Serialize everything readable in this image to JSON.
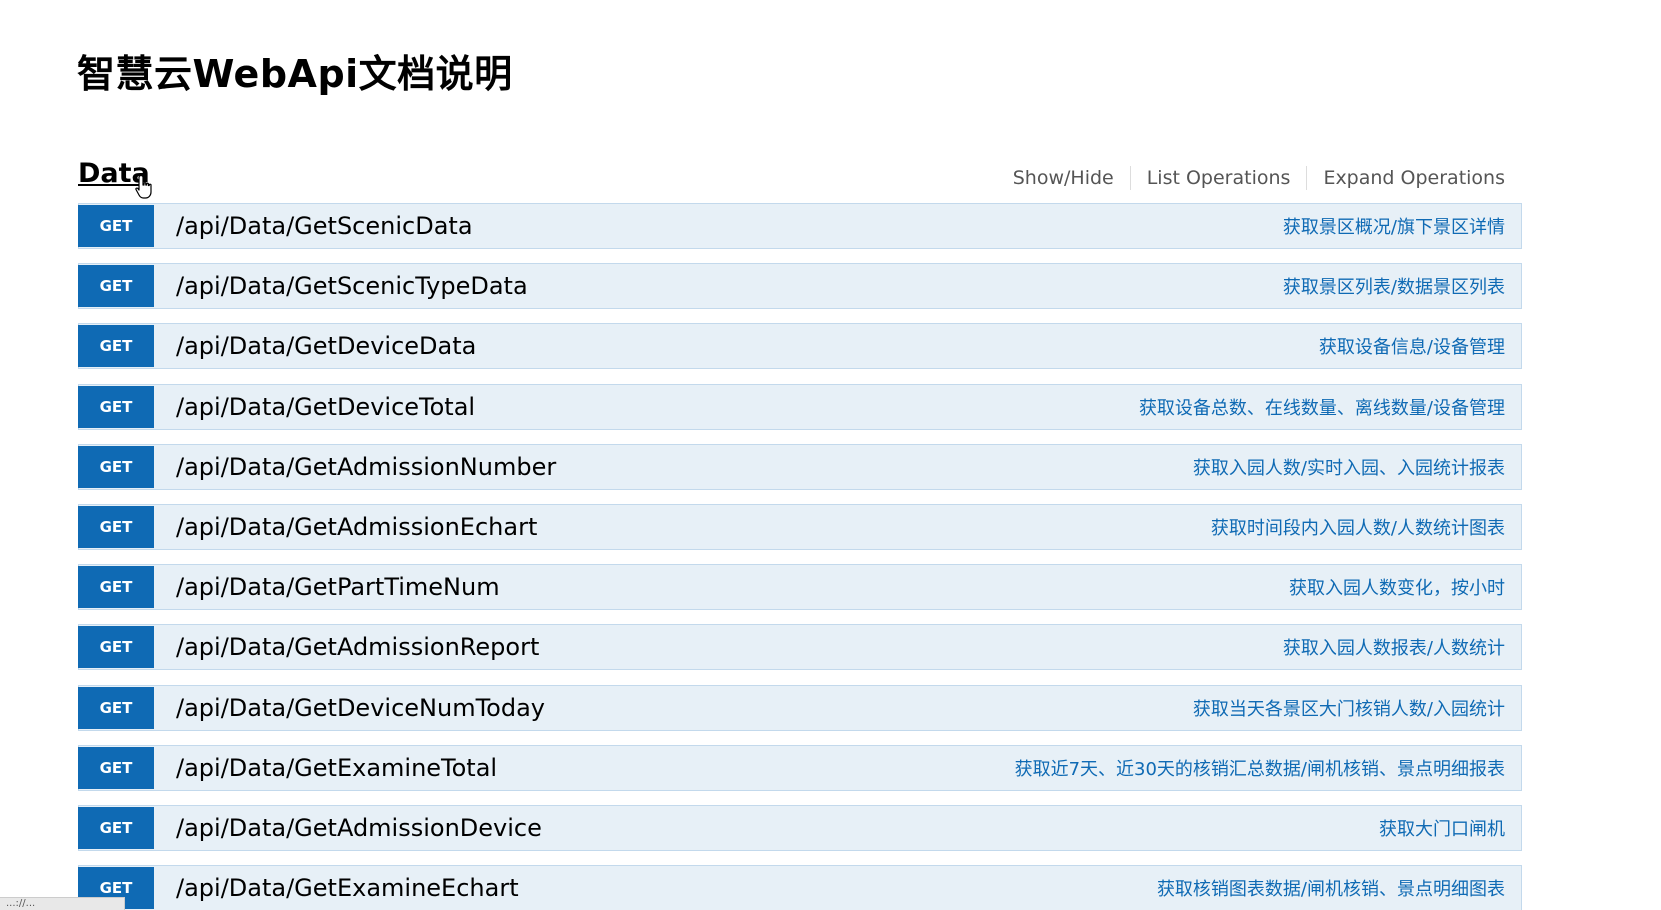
{
  "page": {
    "title": "智慧云WebApi文档说明"
  },
  "section": {
    "name": "Data",
    "actions": [
      "Show/Hide",
      "List Operations",
      "Expand Operations"
    ]
  },
  "operations": [
    {
      "method": "GET",
      "path": "/api/Data/GetScenicData",
      "summary": "获取景区概况/旗下景区详情"
    },
    {
      "method": "GET",
      "path": "/api/Data/GetScenicTypeData",
      "summary": "获取景区列表/数据景区列表"
    },
    {
      "method": "GET",
      "path": "/api/Data/GetDeviceData",
      "summary": "获取设备信息/设备管理"
    },
    {
      "method": "GET",
      "path": "/api/Data/GetDeviceTotal",
      "summary": "获取设备总数、在线数量、离线数量/设备管理"
    },
    {
      "method": "GET",
      "path": "/api/Data/GetAdmissionNumber",
      "summary": "获取入园人数/实时入园、入园统计报表"
    },
    {
      "method": "GET",
      "path": "/api/Data/GetAdmissionEchart",
      "summary": "获取时间段内入园人数/人数统计图表"
    },
    {
      "method": "GET",
      "path": "/api/Data/GetPartTimeNum",
      "summary": "获取入园人数变化，按小时"
    },
    {
      "method": "GET",
      "path": "/api/Data/GetAdmissionReport",
      "summary": "获取入园人数报表/人数统计"
    },
    {
      "method": "GET",
      "path": "/api/Data/GetDeviceNumToday",
      "summary": "获取当天各景区大门核销人数/入园统计"
    },
    {
      "method": "GET",
      "path": "/api/Data/GetExamineTotal",
      "summary": "获取近7天、近30天的核销汇总数据/闸机核销、景点明细报表"
    },
    {
      "method": "GET",
      "path": "/api/Data/GetAdmissionDevice",
      "summary": "获取大门口闸机"
    },
    {
      "method": "GET",
      "path": "/api/Data/GetExamineEchart",
      "summary": "获取核销图表数据/闸机核销、景点明细图表"
    }
  ],
  "status_bar": {
    "text": "...://..."
  },
  "colors": {
    "method_get": "#0f6ab4",
    "row_background": "#e7f0f7",
    "row_border": "#c3d9ec",
    "summary_text": "#0f6ab4"
  },
  "icons": {
    "cursor": "hand-pointer-icon"
  }
}
